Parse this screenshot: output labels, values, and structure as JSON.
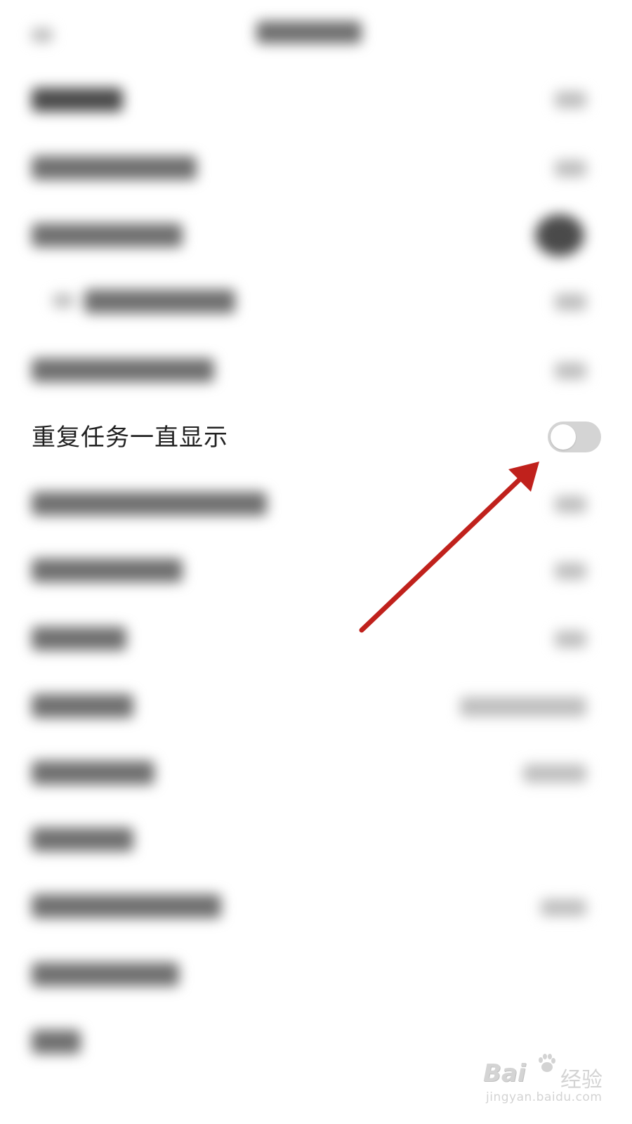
{
  "setting_row": {
    "label": "重复任务一直显示",
    "toggle_on": false
  },
  "annotation": {
    "color": "#c0211c"
  },
  "watermark": {
    "logo_text": "Bai",
    "logo_text_2": "经验",
    "url": "jingyan.baidu.com"
  }
}
